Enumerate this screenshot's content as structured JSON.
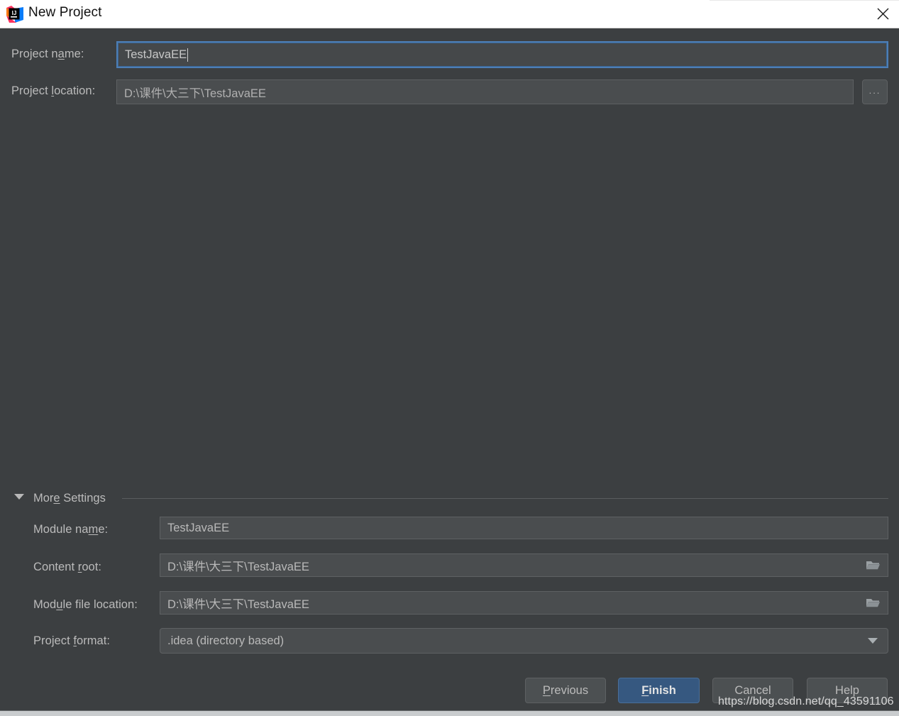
{
  "window": {
    "title": "New Project",
    "app_icon": "intellij-idea-logo",
    "close_icon": "close-icon"
  },
  "form": {
    "project_name": {
      "label_pre": "Project n",
      "label_mnemonic": "a",
      "label_post": "me:",
      "value": "TestJavaEE",
      "focused": true
    },
    "project_location": {
      "label_pre": "Project ",
      "label_mnemonic": "l",
      "label_post": "ocation:",
      "value": "D:\\课件\\大三下\\TestJavaEE",
      "browse_label": "..."
    }
  },
  "more_settings": {
    "label_pre": "Mor",
    "label_mnemonic": "e",
    "label_post": " Settings",
    "expanded": true,
    "toggle_icon": "chevron-down-icon",
    "fields": {
      "module_name": {
        "label_pre": "Module na",
        "label_mnemonic": "m",
        "label_post": "e:",
        "value": "TestJavaEE"
      },
      "content_root": {
        "label_pre": "Content ",
        "label_mnemonic": "r",
        "label_post": "oot:",
        "value": "D:\\课件\\大三下\\TestJavaEE",
        "icon": "folder-icon"
      },
      "module_file_location": {
        "label_pre": "Mod",
        "label_mnemonic": "u",
        "label_post": "le file location:",
        "value": "D:\\课件\\大三下\\TestJavaEE",
        "icon": "folder-icon"
      },
      "project_format": {
        "label_pre": "Project ",
        "label_mnemonic": "f",
        "label_post": "ormat:",
        "value": ".idea (directory based)",
        "icon": "chevron-down-icon"
      }
    }
  },
  "buttons": {
    "previous": {
      "pre": "",
      "mnemonic": "P",
      "post": "revious"
    },
    "finish": {
      "pre": "",
      "mnemonic": "F",
      "post": "inish"
    },
    "cancel": {
      "pre": "Cancel",
      "mnemonic": "",
      "post": ""
    },
    "help": {
      "pre": "Help",
      "mnemonic": "",
      "post": ""
    }
  },
  "watermark": "https://blog.csdn.net/qq_43591106",
  "colors": {
    "dialog_bg": "#3c3f41",
    "field_bg": "#4a4d4f",
    "focus_border": "#4d7eb5",
    "primary_button": "#365880",
    "text": "#bbbbbb",
    "titlebar_bg": "#ffffff"
  }
}
